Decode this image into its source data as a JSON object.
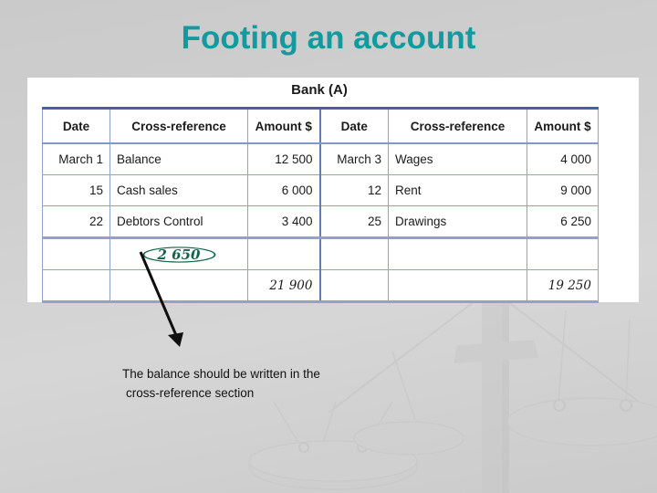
{
  "slide": {
    "title": "Footing an account",
    "title_color": "#119ba0",
    "background_color": "#d0d0d0",
    "watermark": "balance-scales-image"
  },
  "ledger": {
    "account_title": "Bank (A)",
    "headers": [
      "Date",
      "Cross-reference",
      "Amount $",
      "Date",
      "Cross-reference",
      "Amount $"
    ],
    "rows": [
      {
        "left_date": "March   1",
        "left_ref": "Balance",
        "left_amount": "12 500",
        "right_date": "March   3",
        "right_ref": "Wages",
        "right_amount": "4 000"
      },
      {
        "left_date": "15",
        "left_ref": "Cash sales",
        "left_amount": "6 000",
        "right_date": "12",
        "right_ref": "Rent",
        "right_amount": "9 000"
      },
      {
        "left_date": "22",
        "left_ref": "Debtors Control",
        "left_amount": "3 400",
        "right_date": "25",
        "right_ref": "Drawings",
        "right_amount": "6 250"
      }
    ],
    "balance_row": {
      "left_date": "",
      "left_ref": "2 650",
      "left_ref_color": "#11654a",
      "left_amount": "",
      "right_date": "",
      "right_ref": "",
      "right_amount": ""
    },
    "total_row": {
      "left_date": "",
      "left_ref": "",
      "left_amount": "21 900",
      "left_amount_color": "#2d58b5",
      "right_date": "",
      "right_ref": "",
      "right_amount": "19 250",
      "right_amount_color": "#cf1f2a"
    }
  },
  "annotation": {
    "caption_line1": "The balance should be written in the",
    "caption_line2": "cross-reference section",
    "arrow": "down-right-arrow",
    "highlight_circle": "green-ellipse"
  }
}
